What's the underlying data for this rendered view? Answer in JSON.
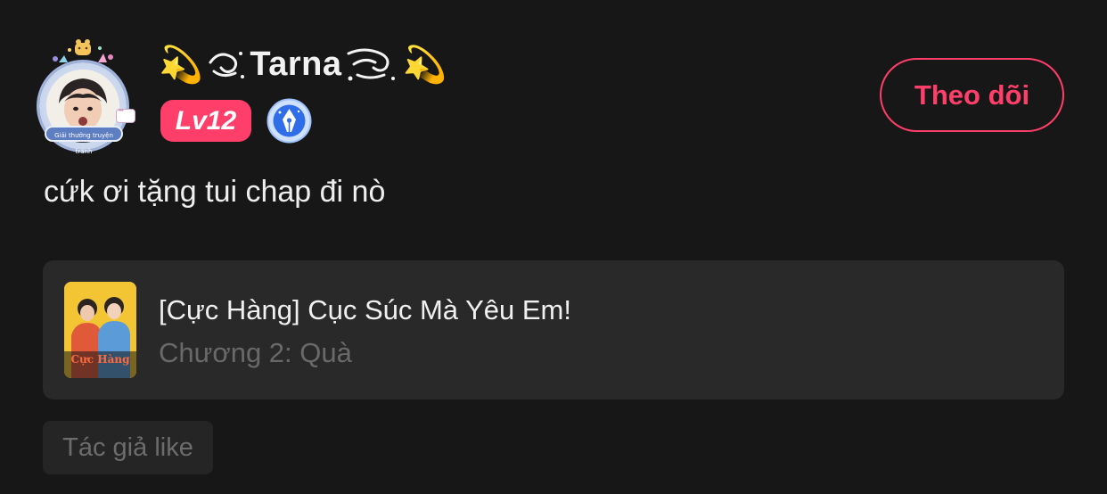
{
  "user": {
    "name": "Tarna",
    "level_badge": "Lv12",
    "avatar_frame_label": "Giải thưởng truyện tranh",
    "verified_badge_icon": "pen-nib-icon",
    "prefix_decoration": "💫",
    "suffix_decoration": "💫"
  },
  "actions": {
    "follow_label": "Theo dõi"
  },
  "comment": {
    "text": "cứk ơi tặng tui chap đi nò"
  },
  "chapter": {
    "title": "[Cực Hàng] Cục Súc Mà Yêu Em!",
    "subtitle": "Chương 2: Quà",
    "cover_text": "Cực Hàng"
  },
  "tag": {
    "label": "Tác giả like"
  },
  "colors": {
    "background": "#181718",
    "accent": "#ff3e6a",
    "card": "#2a292a",
    "muted_text": "#6a696a"
  }
}
